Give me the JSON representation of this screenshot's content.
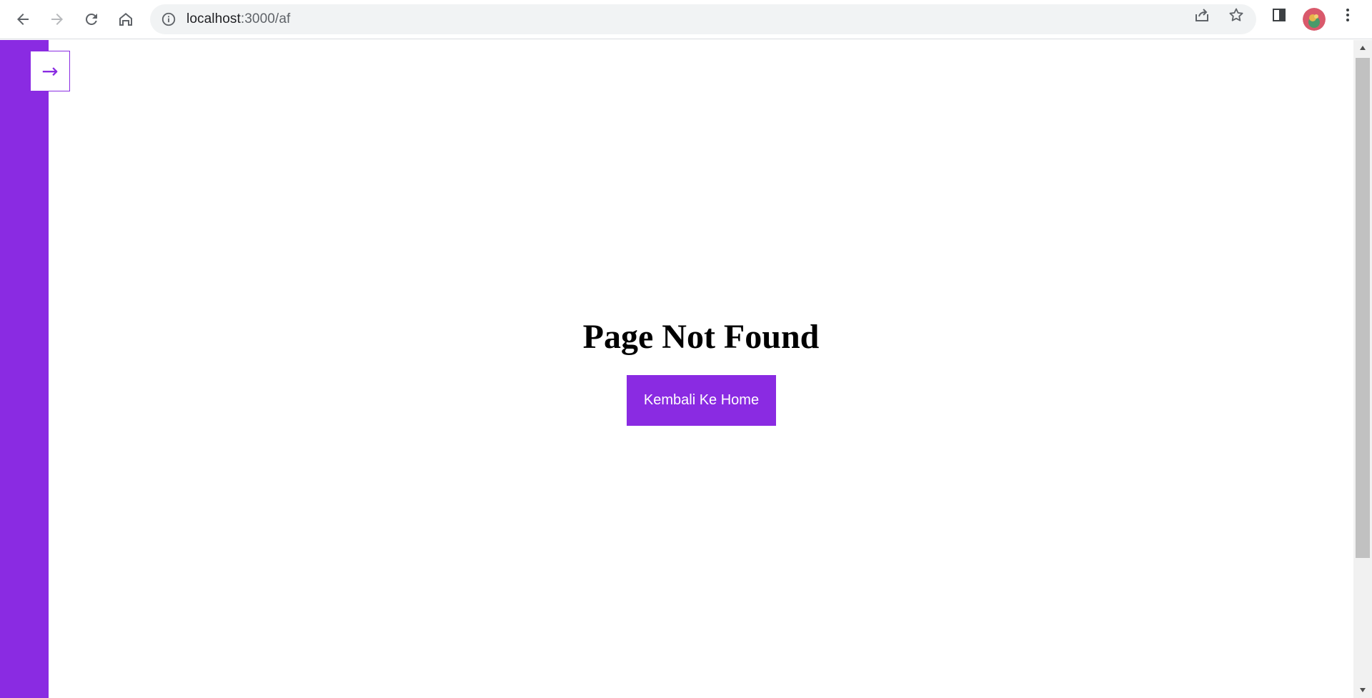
{
  "browser": {
    "url_host": "localhost",
    "url_path": ":3000/af",
    "icons": {
      "back": "arrow-left-icon",
      "forward": "arrow-right-icon",
      "reload": "reload-icon",
      "home": "home-icon",
      "site_info": "info-icon",
      "share": "share-icon",
      "bookmark": "star-icon",
      "side_panel": "side-panel-icon",
      "menu": "kebab-menu-icon"
    }
  },
  "sidebar": {
    "toggle_label": "→",
    "color": "#8a2be2"
  },
  "main": {
    "title": "Page Not Found",
    "home_button_label": "Kembali Ke Home"
  },
  "colors": {
    "accent": "#8a2be2",
    "button_text": "#ffffff"
  }
}
